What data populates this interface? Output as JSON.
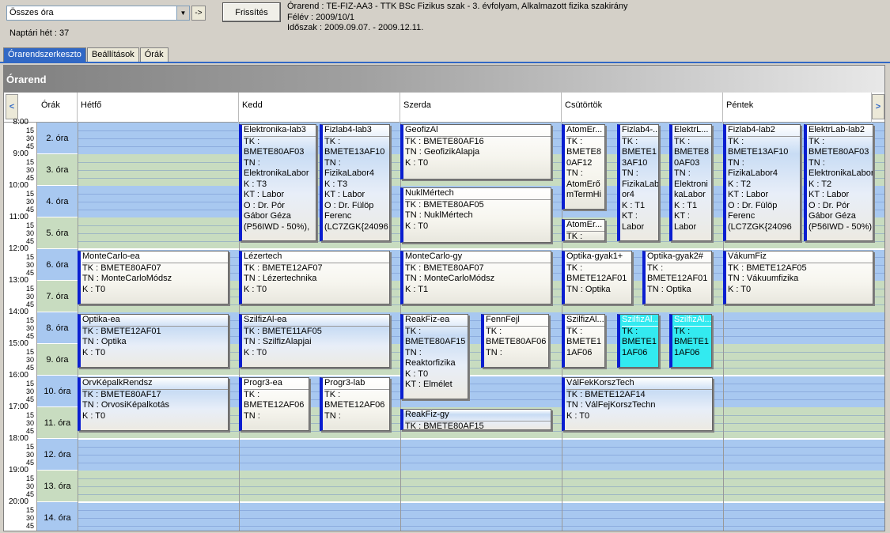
{
  "toolbar": {
    "select_value": "Összes óra",
    "go_label": "->",
    "refresh_label": "Frissítés"
  },
  "info": {
    "line1": "Órarend : TE-FIZ-AA3 - TTK BSc Fizikus szak - 3. évfolyam, Alkalmazott fizika szakirány",
    "line2": "Félév : 2009/10/1",
    "line3": "Időszak : 2009.09.07. - 2009.12.11."
  },
  "week": "Naptári hét : 37",
  "tabs": [
    "Órarendszerkeszto",
    "Beállítások",
    "Órák"
  ],
  "panel_title": "Órarend",
  "header": {
    "hours": "Órák",
    "days": [
      "Hétfő",
      "Kedd",
      "Szerda",
      "Csütörtök",
      "Péntek"
    ],
    "prev": "<",
    "next": ">"
  },
  "times": [
    {
      "hh": "8:00",
      "q": [
        "15",
        "30",
        "45"
      ]
    },
    {
      "hh": "9:00",
      "q": [
        "15",
        "30",
        "45"
      ]
    },
    {
      "hh": "10:00",
      "q": [
        "15",
        "30",
        "45"
      ]
    },
    {
      "hh": "11:00",
      "q": [
        "15",
        "30",
        "45"
      ]
    },
    {
      "hh": "12:00",
      "q": [
        "15",
        "30",
        "45"
      ]
    },
    {
      "hh": "13:00",
      "q": [
        "15",
        "30",
        "45"
      ]
    },
    {
      "hh": "14:00",
      "q": [
        "15",
        "30",
        "45"
      ]
    },
    {
      "hh": "15:00",
      "q": [
        "15",
        "30",
        "45"
      ]
    },
    {
      "hh": "16:00",
      "q": [
        "15",
        "30",
        "45"
      ]
    },
    {
      "hh": "17:00",
      "q": [
        "15",
        "30",
        "45"
      ]
    },
    {
      "hh": "18:00",
      "q": [
        "15",
        "30",
        "45"
      ]
    },
    {
      "hh": "19:00",
      "q": [
        "15",
        "30",
        "45"
      ]
    },
    {
      "hh": "20:00",
      "q": [
        "15",
        "30",
        "45"
      ]
    }
  ],
  "lessons": [
    "2. óra",
    "3. óra",
    "4. óra",
    "5. óra",
    "6. óra",
    "7. óra",
    "8. óra",
    "9. óra",
    "10. óra",
    "11. óra",
    "12. óra",
    "13. óra",
    "14. óra"
  ],
  "cards": [
    {
      "title": "Elektronika-lab3",
      "lines": [
        "TK :",
        "BMETE80AF03",
        "TN :",
        "ElektronikaLabor",
        "K : T3",
        "KT : Labor",
        "O : Dr. Pór",
        "Gábor Géza",
        "(P56IWD - 50%),"
      ],
      "style": "blueg"
    },
    {
      "title": "Fizlab4-lab3",
      "lines": [
        "TK :",
        "BMETE13AF10",
        "TN :",
        "FizikaLabor4",
        "K : T3",
        "KT : Labor",
        "O : Dr. Fülöp",
        "Ferenc",
        "(LC7ZGK{24096"
      ],
      "style": "blueg"
    },
    {
      "title": "GeofizAl",
      "lines": [
        "TK : BMETE80AF16",
        "TN : GeofizikAlapja",
        "K : T0"
      ],
      "style": ""
    },
    {
      "title": "NuklMértech",
      "lines": [
        "TK : BMETE80AF05",
        "TN : NuklMértech",
        "K : T0"
      ],
      "style": ""
    },
    {
      "title": "AtomEr...",
      "lines": [
        "TK :",
        "BMETE8",
        "0AF12",
        "TN :",
        "AtomErő",
        "mTermHi"
      ],
      "style": ""
    },
    {
      "title": "AtomEr...",
      "lines": [
        "TK :"
      ],
      "style": ""
    },
    {
      "title": "Fizlab4-...",
      "lines": [
        "TK :",
        "BMETE1",
        "3AF10",
        "TN :",
        "FizikaLab",
        "or4",
        "K : T1",
        "KT :",
        "Labor"
      ],
      "style": "blueg"
    },
    {
      "title": "ElektrL...",
      "lines": [
        "TK :",
        "BMETE8",
        "0AF03",
        "TN :",
        "Elektroni",
        "kaLabor",
        "K : T1",
        "KT :",
        "Labor"
      ],
      "style": "blueg"
    },
    {
      "title": "Fizlab4-lab2",
      "lines": [
        "TK :",
        "BMETE13AF10",
        "TN :",
        "FizikaLabor4",
        "K : T2",
        "KT : Labor",
        "O : Dr. Fülöp",
        "Ferenc",
        "(LC7ZGK{24096"
      ],
      "style": "blueg"
    },
    {
      "title": "ElektrLab-lab2",
      "lines": [
        "TK :",
        "BMETE80AF03",
        "TN :",
        "ElektronikaLabor",
        "K : T2",
        "KT : Labor",
        "O : Dr. Pór",
        "Gábor Géza",
        "(P56IWD - 50%),"
      ],
      "style": "blueg"
    },
    {
      "title": "MonteCarlo-ea",
      "lines": [
        "TK : BMETE80AF07",
        "TN : MonteCarloMódsz",
        "K : T0"
      ],
      "style": ""
    },
    {
      "title": "Lézertech",
      "lines": [
        "TK : BMETE12AF07",
        "TN : Lézertechnika",
        "K : T0"
      ],
      "style": ""
    },
    {
      "title": "MonteCarlo-gy",
      "lines": [
        "TK : BMETE80AF07",
        "TN : MonteCarloMódsz",
        "K : T1"
      ],
      "style": ""
    },
    {
      "title": "Optika-gyak1+",
      "lines": [
        "TK :",
        "BMETE12AF01",
        "TN : Optika"
      ],
      "style": ""
    },
    {
      "title": "Optika-gyak2#",
      "lines": [
        "TK :",
        "BMETE12AF01",
        "TN : Optika"
      ],
      "style": ""
    },
    {
      "title": "VákumFiz",
      "lines": [
        "TK : BMETE12AF05",
        "TN : Vákuumfizika",
        "K : T0"
      ],
      "style": ""
    },
    {
      "title": "Optika-ea",
      "lines": [
        "TK : BMETE12AF01",
        "TN : Optika",
        "K : T0"
      ],
      "style": "blueg"
    },
    {
      "title": "SzilfizAl-ea",
      "lines": [
        "TK : BMETE11AF05",
        "TN : SzilfizAlapjai",
        "K : T0"
      ],
      "style": "blueg"
    },
    {
      "title": "ReakFiz-ea",
      "lines": [
        "TK :",
        "BMETE80AF15",
        "TN :",
        "Reaktorfizika",
        "K : T0",
        "KT : Elmélet"
      ],
      "style": "blueg"
    },
    {
      "title": "FennFejl",
      "lines": [
        "TK :",
        "BMETE80AF06",
        "TN :"
      ],
      "style": ""
    },
    {
      "title": "SzilfizAl...",
      "lines": [
        "TK :",
        "BMETE1",
        "1AF06"
      ],
      "style": ""
    },
    {
      "title": "SzilfizAl...",
      "lines": [
        "TK :",
        "BMETE1",
        "1AF06"
      ],
      "style": "cyan"
    },
    {
      "title": "SzilfizAl...",
      "lines": [
        "TK :",
        "BMETE1",
        "1AF06"
      ],
      "style": "cyan"
    },
    {
      "title": "OrvKépalkRendsz",
      "lines": [
        "TK : BMETE80AF17",
        "TN : OrvosiKépalkotás",
        "K : T0"
      ],
      "style": "blueg"
    },
    {
      "title": "Progr3-ea",
      "lines": [
        "TK :",
        "BMETE12AF06",
        "TN :"
      ],
      "style": ""
    },
    {
      "title": "Progr3-lab",
      "lines": [
        "TK :",
        "BMETE12AF06",
        "TN :"
      ],
      "style": ""
    },
    {
      "title": "ReakFiz-gy",
      "lines": [
        "TK : BMETE80AF15"
      ],
      "style": "blueg"
    },
    {
      "title": "VálFekKorszTech",
      "lines": [
        "TK : BMETE12AF14",
        "TN : VálFejKorszTechn",
        "K : T0"
      ],
      "style": "blueg"
    }
  ]
}
